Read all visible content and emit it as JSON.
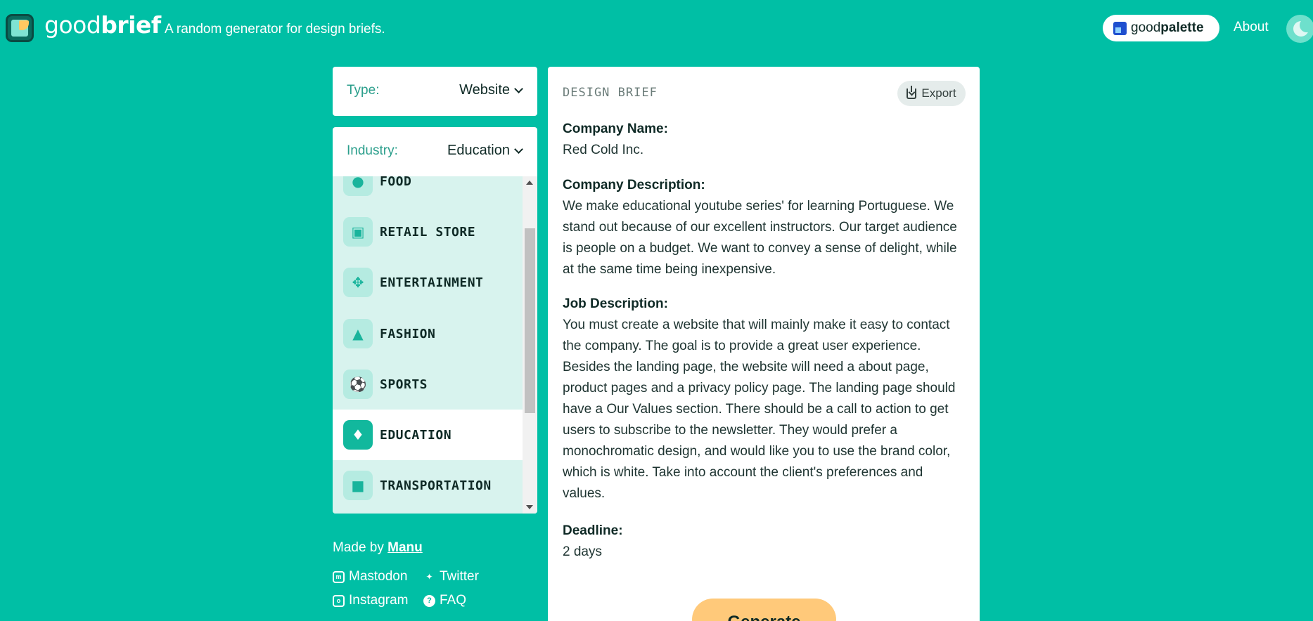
{
  "header": {
    "brand_light": "good",
    "brand_bold": "brief",
    "tagline": "A random generator for design briefs.",
    "palette_light": "good",
    "palette_bold": "palette",
    "about": "About"
  },
  "type_select": {
    "label": "Type:",
    "value": "Website"
  },
  "industry_select": {
    "label": "Industry:",
    "value": "Education",
    "items": [
      {
        "label": "FOOD",
        "icon": "food-icon"
      },
      {
        "label": "RETAIL STORE",
        "icon": "store-icon"
      },
      {
        "label": "ENTERTAINMENT",
        "icon": "gamepad-icon"
      },
      {
        "label": "FASHION",
        "icon": "shirt-icon"
      },
      {
        "label": "SPORTS",
        "icon": "soccer-ball-icon"
      },
      {
        "label": "EDUCATION",
        "icon": "graduation-cap-icon",
        "selected": true
      },
      {
        "label": "TRANSPORTATION",
        "icon": "car-icon"
      }
    ]
  },
  "footer": {
    "made_by": "Made by",
    "author": "Manu",
    "links": [
      "Mastodon",
      "Twitter",
      "Instagram",
      "FAQ"
    ]
  },
  "brief": {
    "title": "DESIGN BRIEF",
    "export": "Export",
    "company_name_label": "Company Name:",
    "company_name": "Red Cold Inc.",
    "company_description_label": "Company Description:",
    "company_description": "We make educational youtube series' for learning Portuguese. We stand out because of our excellent instructors. Our target audience is people on a budget. We want to convey a sense of delight, while at the same time being inexpensive.",
    "job_description_label": "Job Description:",
    "job_description": "You must create a website that will mainly make it easy to contact the company. The goal is to provide a great user experience. Besides the landing page, the website will need a about page, product pages and a privacy policy page. The landing page should have a Our Values section. There should be a call to action to get users to subscribe to the newsletter. They would prefer a monochromatic design, and would like you to use the brand color, which is white. Take into account the client's preferences and values.",
    "deadline_label": "Deadline:",
    "deadline": "2 days",
    "generate": "Generate"
  },
  "colors": {
    "background": "#00bfa5",
    "accent_button": "#ffc97a",
    "list_background": "#d8f3ee"
  }
}
